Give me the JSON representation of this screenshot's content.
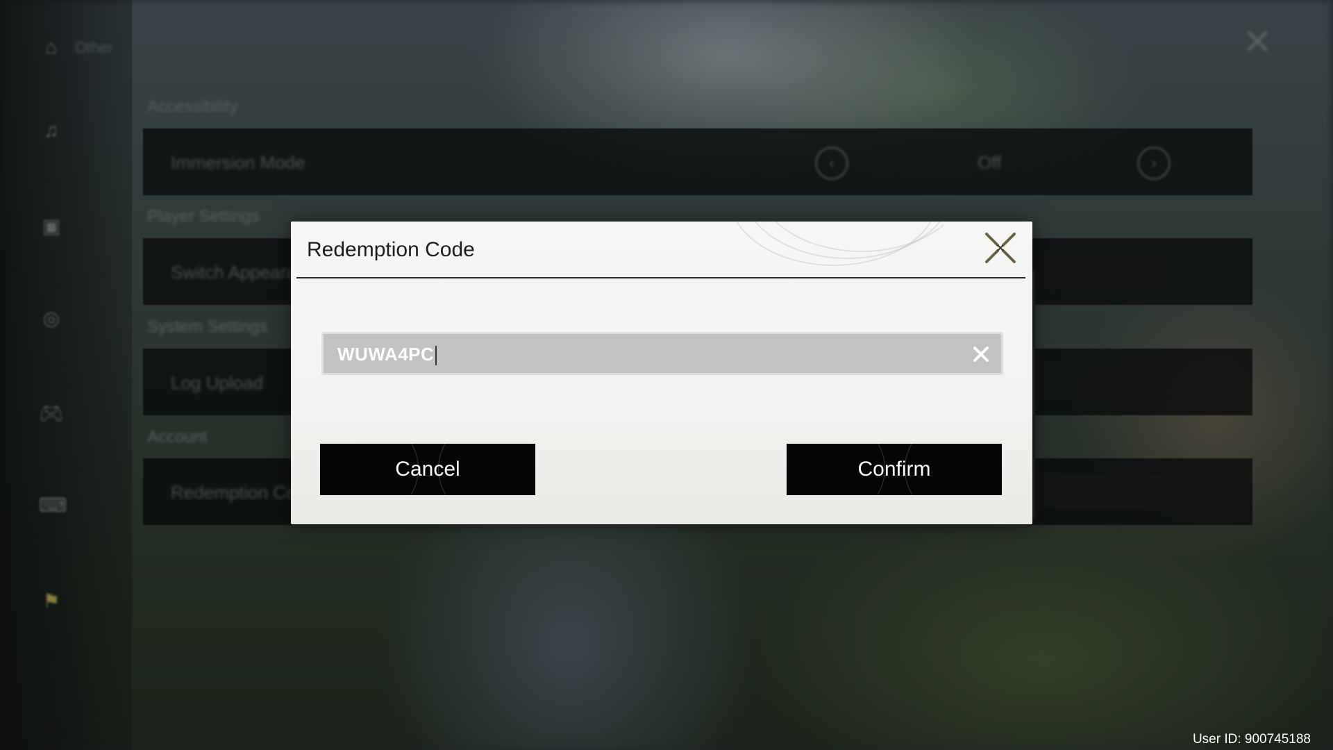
{
  "background": {
    "header_title": "Other",
    "sections": [
      {
        "label": "Accessibility"
      },
      {
        "label": "Player Settings"
      },
      {
        "label": "System Settings"
      },
      {
        "label": "Account"
      }
    ],
    "rows": [
      {
        "label": "Immersion Mode",
        "value": "Off"
      },
      {
        "label": "Switch Appearance"
      },
      {
        "label": "Log Upload"
      },
      {
        "label": "Redemption Code"
      }
    ]
  },
  "dialog": {
    "title": "Redemption Code",
    "input_value": "WUWA4PC",
    "cancel_label": "Cancel",
    "confirm_label": "Confirm"
  },
  "footer": {
    "user_id": "User ID: 900745188"
  },
  "colors": {
    "dialog_bg": "#f4f4f2",
    "button_bg": "#050505",
    "input_bg": "#c2c2c2",
    "close_icon": "#6b5f45"
  }
}
